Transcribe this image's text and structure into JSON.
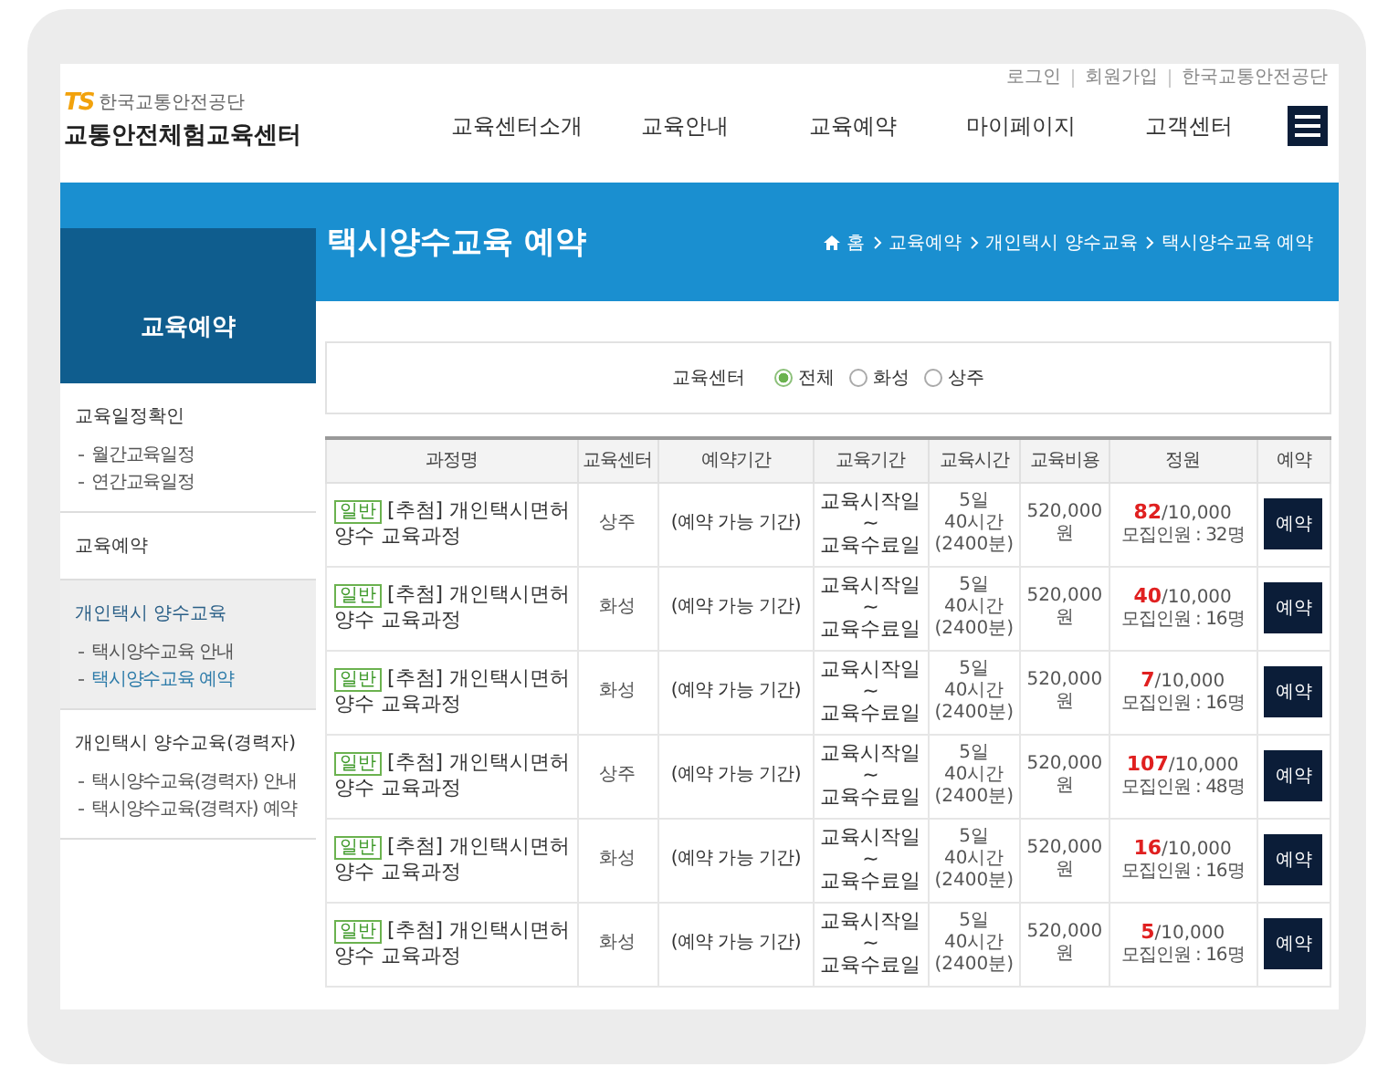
{
  "header": {
    "top_links": [
      "로그인",
      "회원가입",
      "한국교통안전공단"
    ],
    "logo": {
      "mark": "TS",
      "org": "한국교통안전공단",
      "name": "교통안전체험교육센터"
    },
    "nav": [
      "교육센터소개",
      "교육안내",
      "교육예약",
      "마이페이지",
      "고객센터"
    ]
  },
  "banner": {
    "title": "택시양수교육 예약",
    "breadcrumb": [
      "홈",
      "교육예약",
      "개인택시 양수교육",
      "택시양수교육 예약"
    ]
  },
  "sidebar": {
    "title": "교육예약",
    "sections": [
      {
        "title": "교육일정확인",
        "active": false,
        "items": [
          {
            "label": "월간교육일정",
            "selected": false
          },
          {
            "label": "연간교육일정",
            "selected": false
          }
        ]
      },
      {
        "title": "교육예약",
        "active": false
      },
      {
        "title": "개인택시 양수교육",
        "active": true,
        "items": [
          {
            "label": "택시양수교육 안내",
            "selected": false
          },
          {
            "label": "택시양수교육 예약",
            "selected": true
          }
        ]
      },
      {
        "title": "개인택시 양수교육(경력자)",
        "active": false,
        "items": [
          {
            "label": "택시양수교육(경력자) 안내",
            "selected": false
          },
          {
            "label": "택시양수교육(경력자) 예약",
            "selected": false
          }
        ]
      }
    ]
  },
  "filter": {
    "label": "교육센터",
    "options": [
      {
        "label": "전체",
        "selected": true
      },
      {
        "label": "화성",
        "selected": false
      },
      {
        "label": "상주",
        "selected": false
      }
    ]
  },
  "table": {
    "columns": [
      "과정명",
      "교육센터",
      "예약기간",
      "교육기간",
      "교육시간",
      "교육비용",
      "정원",
      "예약"
    ],
    "rows": [
      {
        "badge": "일반",
        "course": [
          "[추첨] 개인택시면허",
          "양수 교육과정"
        ],
        "center": "상주",
        "period": "(예약 가능 기간)",
        "dates": [
          "교육시작일",
          "~",
          "교육수료일"
        ],
        "hours": [
          "5일",
          "40시간",
          "(2400분)"
        ],
        "fee": [
          "520,000",
          "원"
        ],
        "applied": "82",
        "capacity": "/10,000",
        "recruit": "모집인원 : 32명",
        "button": "예약"
      },
      {
        "badge": "일반",
        "course": [
          "[추첨] 개인택시면허",
          "양수 교육과정"
        ],
        "center": "화성",
        "period": "(예약 가능 기간)",
        "dates": [
          "교육시작일",
          "~",
          "교육수료일"
        ],
        "hours": [
          "5일",
          "40시간",
          "(2400분)"
        ],
        "fee": [
          "520,000",
          "원"
        ],
        "applied": "40",
        "capacity": "/10,000",
        "recruit": "모집인원 : 16명",
        "button": "예약"
      },
      {
        "badge": "일반",
        "course": [
          "[추첨] 개인택시면허",
          "양수 교육과정"
        ],
        "center": "화성",
        "period": "(예약 가능 기간)",
        "dates": [
          "교육시작일",
          "~",
          "교육수료일"
        ],
        "hours": [
          "5일",
          "40시간",
          "(2400분)"
        ],
        "fee": [
          "520,000",
          "원"
        ],
        "applied": "7",
        "capacity": "/10,000",
        "recruit": "모집인원 : 16명",
        "button": "예약"
      },
      {
        "badge": "일반",
        "course": [
          "[추첨] 개인택시면허",
          "양수 교육과정"
        ],
        "center": "상주",
        "period": "(예약 가능 기간)",
        "dates": [
          "교육시작일",
          "~",
          "교육수료일"
        ],
        "hours": [
          "5일",
          "40시간",
          "(2400분)"
        ],
        "fee": [
          "520,000",
          "원"
        ],
        "applied": "107",
        "capacity": "/10,000",
        "recruit": "모집인원 : 48명",
        "button": "예약"
      },
      {
        "badge": "일반",
        "course": [
          "[추첨] 개인택시면허",
          "양수 교육과정"
        ],
        "center": "화성",
        "period": "(예약 가능 기간)",
        "dates": [
          "교육시작일",
          "~",
          "교육수료일"
        ],
        "hours": [
          "5일",
          "40시간",
          "(2400분)"
        ],
        "fee": [
          "520,000",
          "원"
        ],
        "applied": "16",
        "capacity": "/10,000",
        "recruit": "모집인원 : 16명",
        "button": "예약"
      },
      {
        "badge": "일반",
        "course": [
          "[추첨] 개인택시면허",
          "양수 교육과정"
        ],
        "center": "화성",
        "period": "(예약 가능 기간)",
        "dates": [
          "교육시작일",
          "~",
          "교육수료일"
        ],
        "hours": [
          "5일",
          "40시간",
          "(2400분)"
        ],
        "fee": [
          "520,000",
          "원"
        ],
        "applied": "5",
        "capacity": "/10,000",
        "recruit": "모집인원 : 16명",
        "button": "예약"
      }
    ]
  }
}
